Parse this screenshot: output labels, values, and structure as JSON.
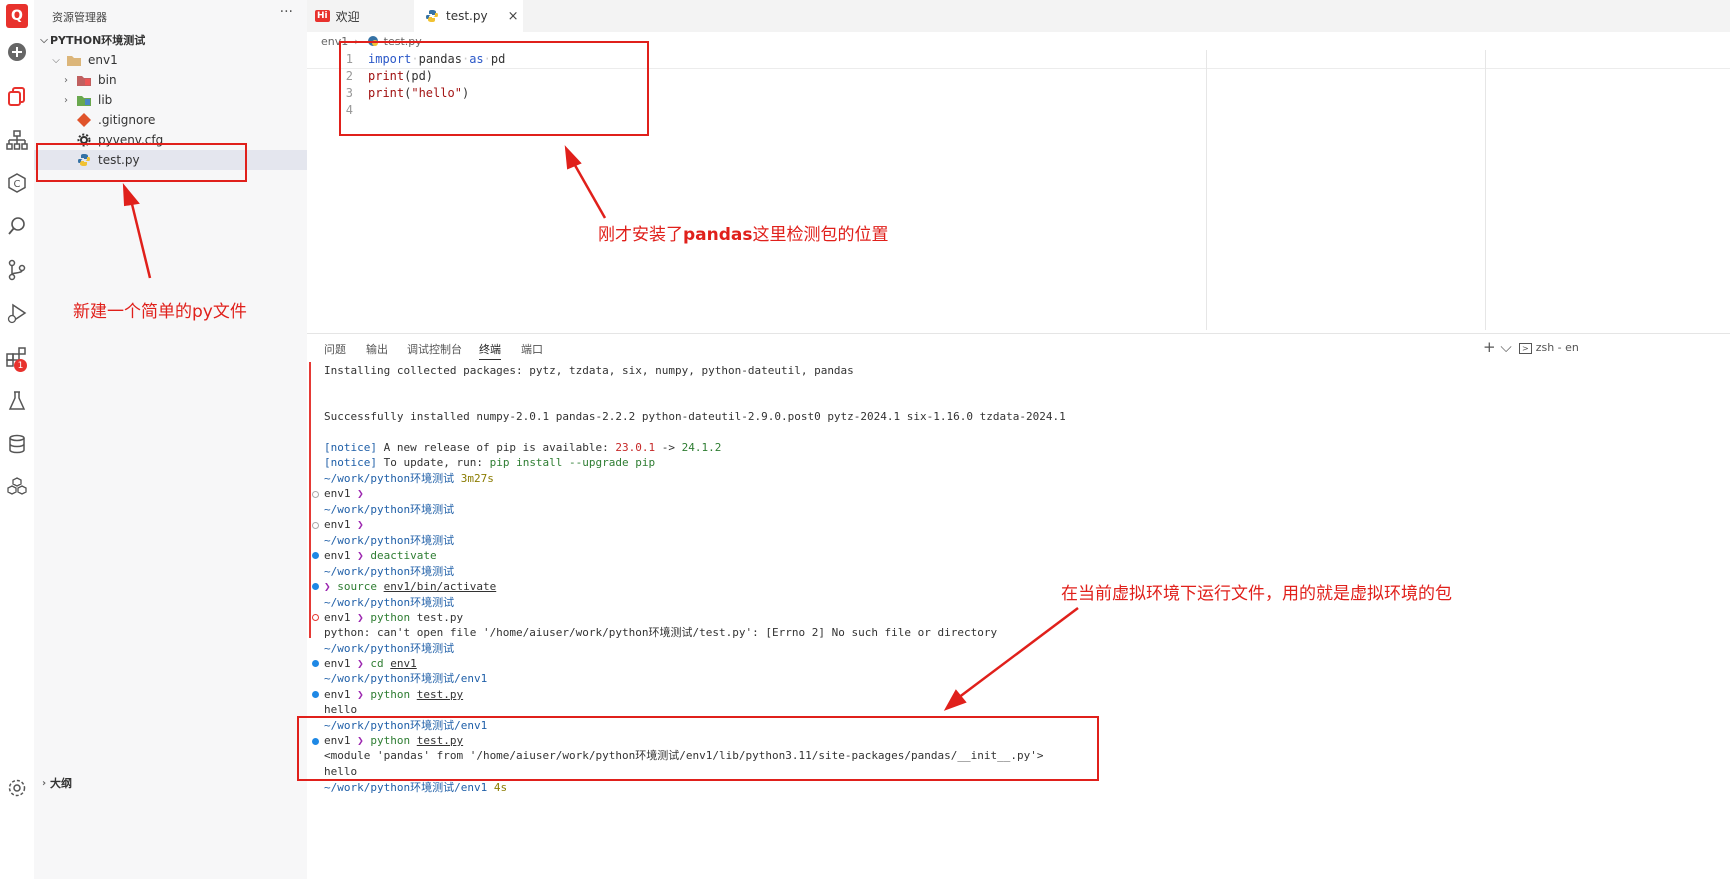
{
  "sidebar": {
    "title": "资源管理器",
    "more": "···",
    "project": "PYTHON环境测试",
    "tree": [
      {
        "label": "env1"
      },
      {
        "label": "bin"
      },
      {
        "label": "lib"
      },
      {
        "label": ".gitignore"
      },
      {
        "label": "pyvenv.cfg"
      },
      {
        "label": "test.py"
      }
    ],
    "outline": "大纲"
  },
  "activity_badge": "1",
  "tabs": [
    {
      "label": "欢迎",
      "icon": "Hi"
    },
    {
      "label": "test.py"
    }
  ],
  "tab_close": "×",
  "breadcrumb": {
    "folder": "env1",
    "file": "test.py"
  },
  "code": {
    "line_numbers": [
      "1",
      "2",
      "3",
      "4"
    ],
    "l1_import": "import",
    "l1_mod": "pandas",
    "l1_as": "as",
    "l1_alias": "pd",
    "l2_print": "print",
    "l2_args": "(pd)",
    "l3_print": "print",
    "l3_open": "(",
    "l3_str": "\"hello\"",
    "l3_close": ")"
  },
  "panel": {
    "tabs": [
      "问题",
      "输出",
      "调试控制台",
      "终端",
      "端口"
    ],
    "plus": "+ ⌵",
    "terminal_name": "zsh - en"
  },
  "terminal": {
    "installing": "Installing collected packages: pytz, tzdata, six, numpy, python-dateutil, pandas",
    "success": "Successfully installed numpy-2.0.1 pandas-2.2.2 python-dateutil-2.9.0.post0 pytz-2024.1 six-1.16.0 tzdata-2024.1",
    "notice_tag": "[notice]",
    "notice1_text": " A new release of pip is available: ",
    "notice1_old": "23.0.1",
    "notice1_arrow": " -> ",
    "notice1_new": "24.1.2",
    "notice2_text": " To update, run: ",
    "notice2_cmd": "pip install --upgrade pip",
    "path_root": "~/work/python环境测试",
    "path_env1": "~/work/python环境测试/env1",
    "time1": "3m27s",
    "time2": "4s",
    "env_prompt": "env1",
    "chevron": "❯",
    "cmd_deactivate": "deactivate",
    "cmd_source": "source",
    "arg_source": "env1/bin/activate",
    "cmd_python": "python",
    "arg_test": "test.py",
    "cmd_cd": "cd",
    "arg_cd": "env1",
    "error": "python: can't open file '/home/aiuser/work/python环境测试/test.py': [Errno 2] No such file or directory",
    "hello": "hello",
    "module": "<module 'pandas' from '/home/aiuser/work/python环境测试/env1/lib/python3.11/site-packages/pandas/__init__.py'>"
  },
  "annotations": {
    "new_file": "新建一个简单的py文件",
    "pandas_check_pre": "刚才安装了",
    "pandas_check_bold": "pandas",
    "pandas_check_post": "这里检测包的位置",
    "venv_run": "在当前虚拟环境下运行文件，用的就是虚拟环境的包"
  },
  "colors": {
    "annotation": "#e0201b",
    "brand": "#e8322d",
    "path": "#1f5fa8",
    "prompt_chevron": "#9c27b0"
  }
}
